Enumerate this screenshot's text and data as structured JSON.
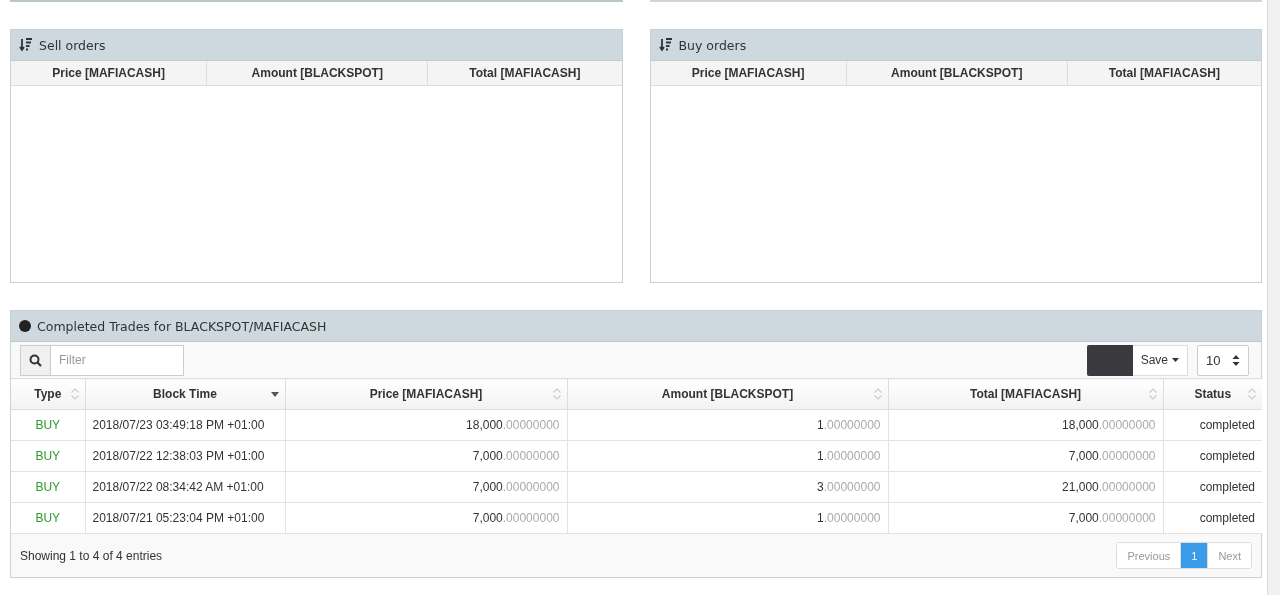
{
  "order_panels": [
    {
      "title": "Sell orders",
      "columns": [
        "Price [MAFIACASH]",
        "Amount [BLACKSPOT]",
        "Total [MAFIACASH]"
      ]
    },
    {
      "title": "Buy orders",
      "columns": [
        "Price [MAFIACASH]",
        "Amount [BLACKSPOT]",
        "Total [MAFIACASH]"
      ]
    }
  ],
  "trades": {
    "title": "Completed Trades for BLACKSPOT/MAFIACASH",
    "filter": {
      "placeholder": "Filter"
    },
    "save_button": "Save",
    "page_length": "10",
    "columns": [
      {
        "label": "Type",
        "sorted": false
      },
      {
        "label": "Block Time",
        "sorted": true
      },
      {
        "label": "Price [MAFIACASH]",
        "sorted": false
      },
      {
        "label": "Amount [BLACKSPOT]",
        "sorted": false
      },
      {
        "label": "Total [MAFIACASH]",
        "sorted": false
      },
      {
        "label": "Status",
        "sorted": false
      }
    ],
    "rows": [
      {
        "type": "BUY",
        "kind": "buy",
        "time": "2018/07/23 03:49:18 PM +01:00",
        "price": [
          "18,000",
          ".00000000"
        ],
        "amount": [
          "1",
          ".00000000"
        ],
        "total": [
          "18,000",
          ".00000000"
        ],
        "status": "completed"
      },
      {
        "type": "BUY",
        "kind": "buy",
        "time": "2018/07/22 12:38:03 PM +01:00",
        "price": [
          "7,000",
          ".00000000"
        ],
        "amount": [
          "1",
          ".00000000"
        ],
        "total": [
          "7,000",
          ".00000000"
        ],
        "status": "completed"
      },
      {
        "type": "BUY",
        "kind": "buy",
        "time": "2018/07/22 08:34:42 AM +01:00",
        "price": [
          "7,000",
          ".00000000"
        ],
        "amount": [
          "3",
          ".00000000"
        ],
        "total": [
          "21,000",
          ".00000000"
        ],
        "status": "completed"
      },
      {
        "type": "BUY",
        "kind": "buy",
        "time": "2018/07/21 05:23:04 PM +01:00",
        "price": [
          "7,000",
          ".00000000"
        ],
        "amount": [
          "1",
          ".00000000"
        ],
        "total": [
          "7,000",
          ".00000000"
        ],
        "status": "completed"
      }
    ],
    "info": "Showing 1 to 4 of 4 entries",
    "pagination": [
      {
        "label": "Previous",
        "selected": false
      },
      {
        "label": "1",
        "selected": true
      },
      {
        "label": "Next",
        "selected": false
      }
    ]
  }
}
